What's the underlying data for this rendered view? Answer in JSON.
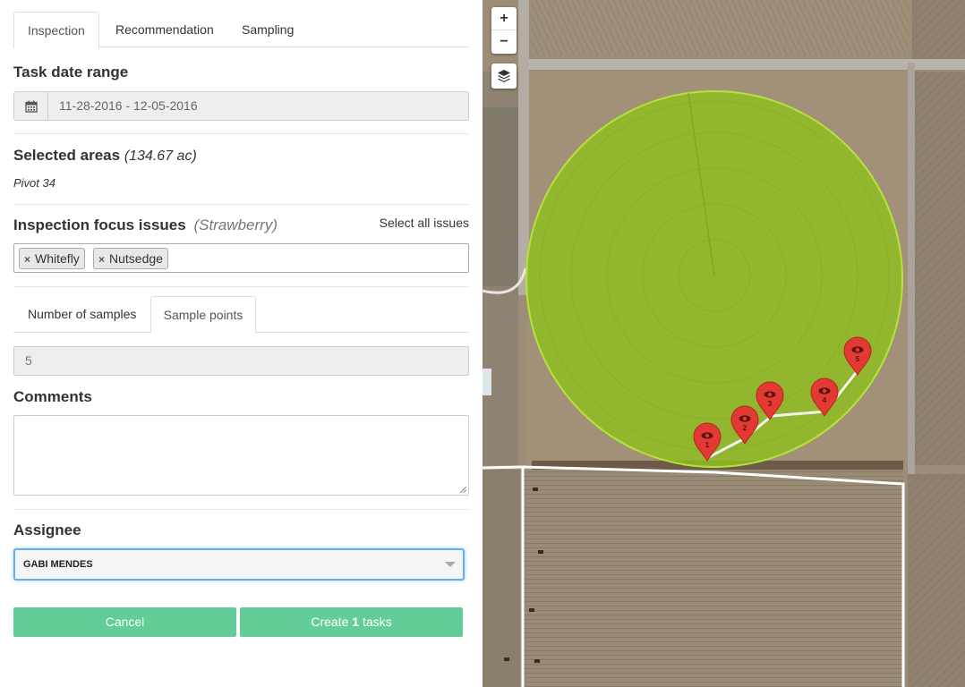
{
  "tabs": {
    "inspection": "Inspection",
    "recommendation": "Recommendation",
    "sampling": "Sampling",
    "active": "Inspection"
  },
  "task_date": {
    "label": "Task date range",
    "value": "11-28-2016 - 12-05-2016",
    "icon": "calendar-icon"
  },
  "areas": {
    "label": "Selected areas",
    "total": "(134.67 ac)",
    "list": "Pivot 34"
  },
  "focus": {
    "label": "Inspection focus issues",
    "crop": "(Strawberry)",
    "select_all": "Select all issues",
    "tags": [
      "Whitefly",
      "Nutsedge"
    ]
  },
  "sample_tabs": {
    "number": "Number of samples",
    "points": "Sample points",
    "active": "Sample points"
  },
  "samples": {
    "value": "5"
  },
  "comments": {
    "label": "Comments",
    "value": ""
  },
  "assignee": {
    "label": "Assignee",
    "value": "GABI MENDES"
  },
  "buttons": {
    "cancel": "Cancel",
    "create_prefix": "Create ",
    "create_count": "1",
    "create_suffix": " tasks"
  },
  "map": {
    "zoom_in": "+",
    "zoom_out": "−",
    "layers_icon": "layers-icon",
    "field_color": "#8fbf1f",
    "marker_color": "#e23a33",
    "markers": [
      "1",
      "2",
      "3",
      "4",
      "5"
    ]
  },
  "colors": {
    "accent_button": "#62cd98",
    "focus_border": "#66afe9"
  }
}
